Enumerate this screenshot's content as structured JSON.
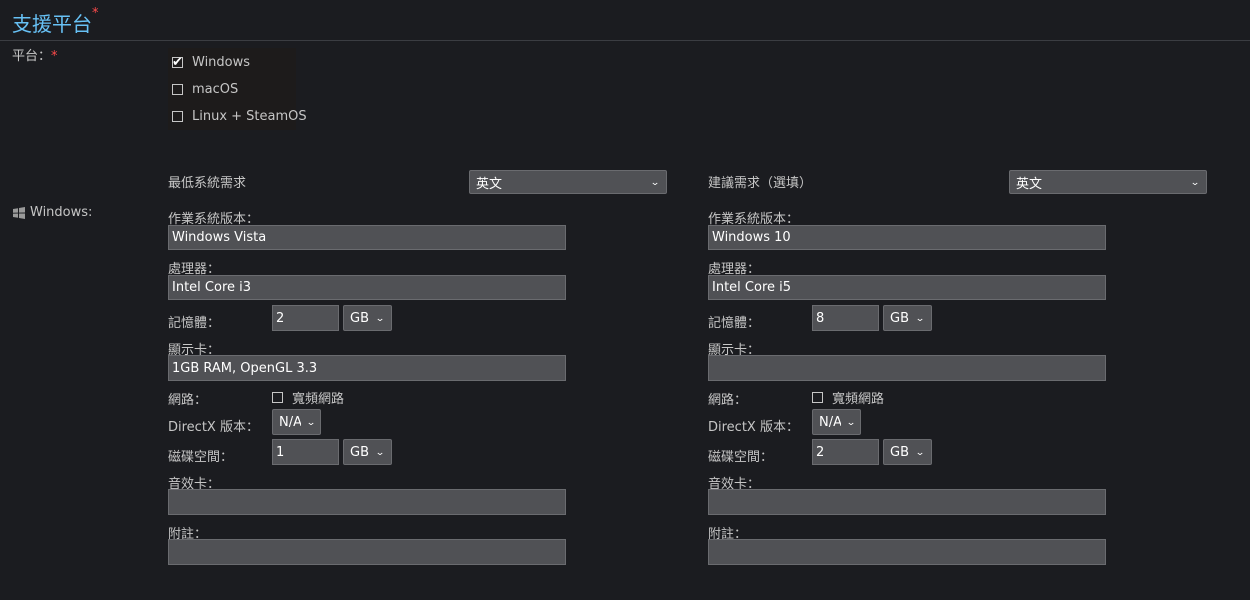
{
  "section": {
    "title": "支援平台",
    "required_mark": "*"
  },
  "platforms": {
    "label": "平台：",
    "required_mark": "*",
    "items": [
      {
        "label": "Windows",
        "checked": true
      },
      {
        "label": "macOS",
        "checked": false
      },
      {
        "label": "Linux + SteamOS",
        "checked": false
      }
    ]
  },
  "windows": {
    "os_label": "Windows:",
    "minimum": {
      "header": "最低系統需求",
      "language": "英文",
      "os_label": "作業系統版本：",
      "os_value": "Windows Vista",
      "processor_label": "處理器：",
      "processor_value": "Intel Core i3",
      "memory_label": "記憶體：",
      "memory_value": "2",
      "memory_unit": "GB",
      "graphics_label": "顯示卡：",
      "graphics_value": "1GB RAM, OpenGL 3.3",
      "network_label": "網路：",
      "broadband_label": "寬頻網路",
      "broadband_checked": false,
      "directx_label": "DirectX 版本：",
      "directx_value": "N/A",
      "storage_label": "磁碟空間：",
      "storage_value": "1",
      "storage_unit": "GB",
      "sound_label": "音效卡：",
      "sound_value": "",
      "notes_label": "附註：",
      "notes_value": ""
    },
    "recommended": {
      "header": "建議需求（選填）",
      "language": "英文",
      "os_label": "作業系統版本：",
      "os_value": "Windows 10",
      "processor_label": "處理器：",
      "processor_value": "Intel Core i5",
      "memory_label": "記憶體：",
      "memory_value": "8",
      "memory_unit": "GB",
      "graphics_label": "顯示卡：",
      "graphics_value": "",
      "network_label": "網路：",
      "broadband_label": "寬頻網路",
      "broadband_checked": false,
      "directx_label": "DirectX 版本：",
      "directx_value": "N/A",
      "storage_label": "磁碟空間：",
      "storage_value": "2",
      "storage_unit": "GB",
      "sound_label": "音效卡：",
      "sound_value": "",
      "notes_label": "附註：",
      "notes_value": ""
    }
  },
  "colors": {
    "accent": "#67c1f5",
    "required": "#ff4a4a",
    "background": "#1b1c20",
    "field": "#505155"
  },
  "icons": {
    "checkbox_checked": "check-icon",
    "select": "chevron-down-icon",
    "os": "windows-logo-icon"
  }
}
